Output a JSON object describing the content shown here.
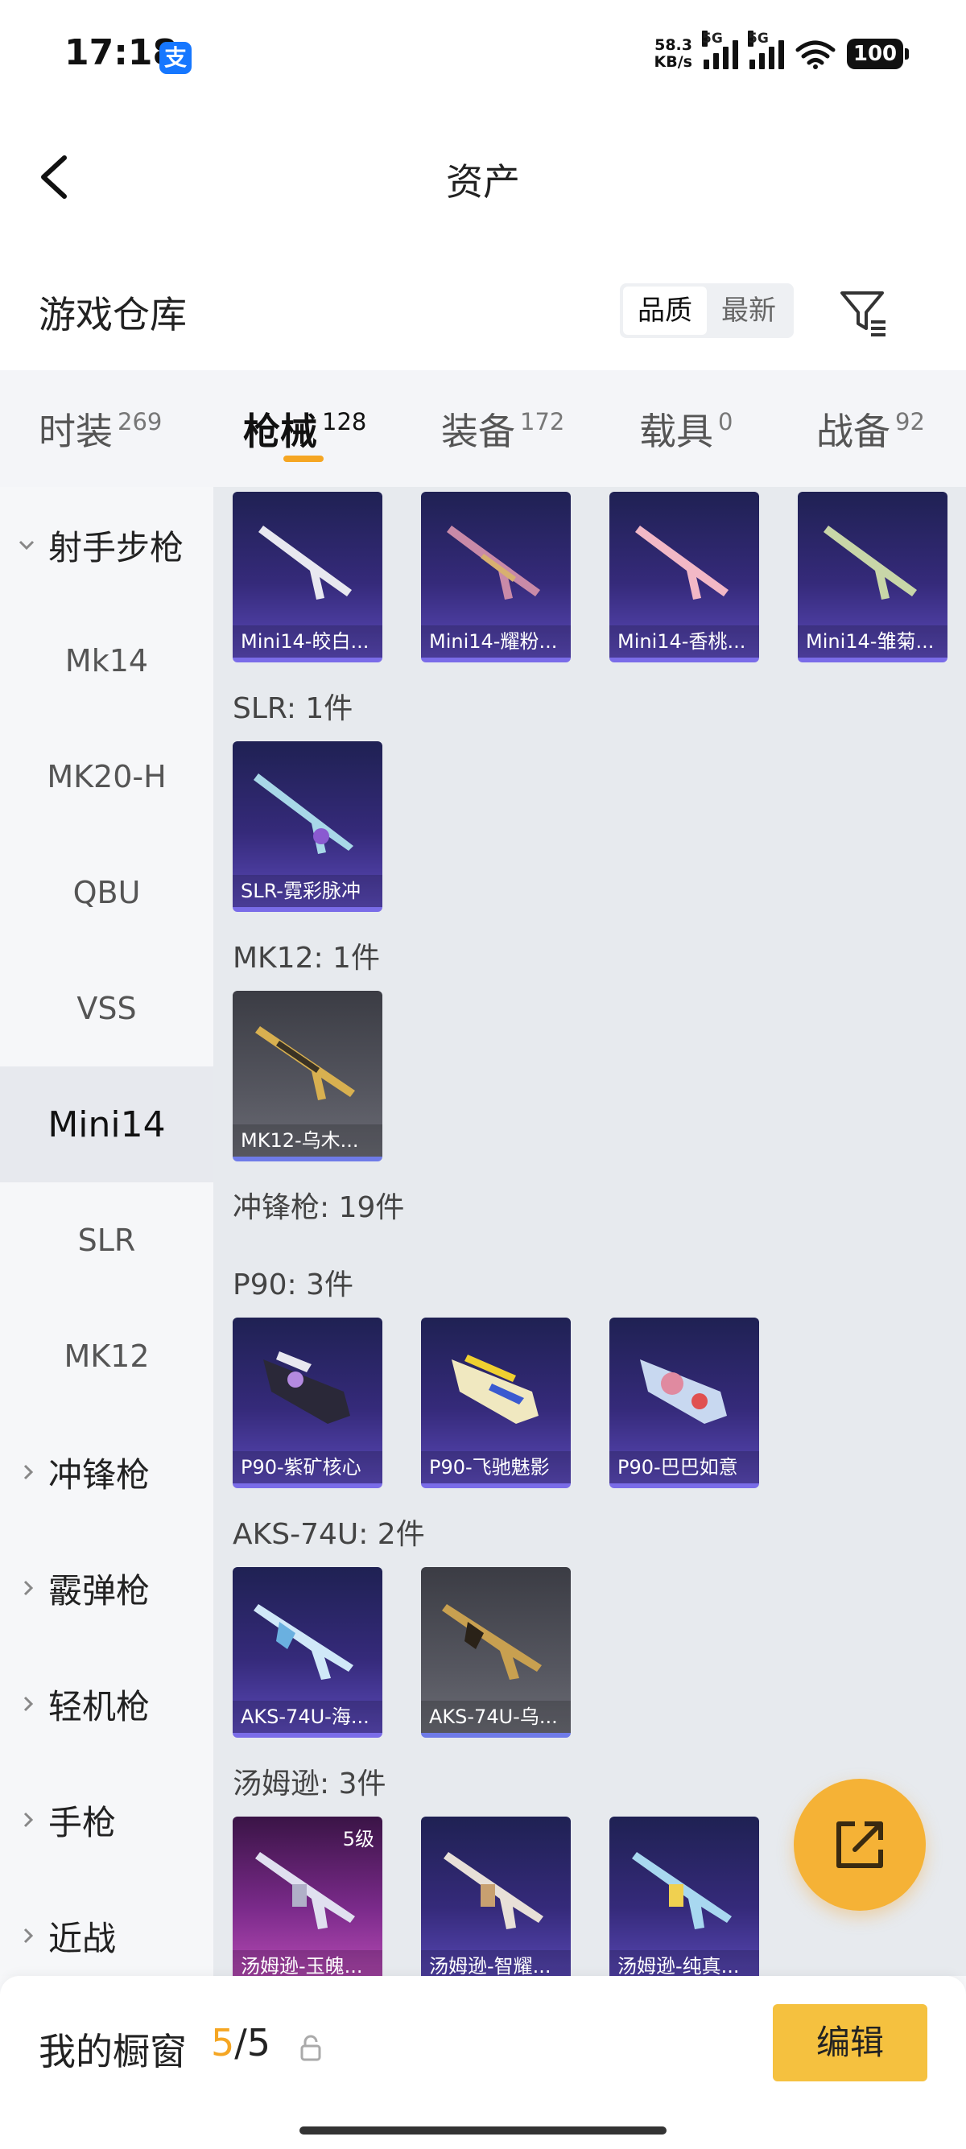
{
  "status": {
    "time": "17:18",
    "app_badge": "支",
    "net_speed_top": "58.3",
    "net_speed_bottom": "KB/s",
    "sig1": "5G",
    "sig2": "5G",
    "battery": "100"
  },
  "header": {
    "title": "资产"
  },
  "warehouse": {
    "title": "游戏仓库",
    "sort_options": [
      "品质",
      "最新"
    ],
    "active_sort": "品质"
  },
  "tabs": [
    {
      "label": "时装",
      "count": "269"
    },
    {
      "label": "枪械",
      "count": "128"
    },
    {
      "label": "装备",
      "count": "172"
    },
    {
      "label": "载具",
      "count": "0"
    },
    {
      "label": "战备",
      "count": "92"
    }
  ],
  "active_tab": "枪械",
  "sidebar": {
    "items": [
      {
        "label": "射手步枪"
      },
      {
        "label": "Mk14"
      },
      {
        "label": "MK20-H"
      },
      {
        "label": "QBU"
      },
      {
        "label": "VSS"
      },
      {
        "label": "Mini14"
      },
      {
        "label": "SLR"
      },
      {
        "label": "MK12"
      },
      {
        "label": "冲锋枪"
      },
      {
        "label": "霰弹枪"
      },
      {
        "label": "轻机枪"
      },
      {
        "label": "手枪"
      },
      {
        "label": "近战"
      }
    ]
  },
  "content": {
    "groups": {
      "slr": "SLR: 1件",
      "mk12": "MK12: 1件",
      "smg": "冲锋枪: 19件",
      "p90": "P90: 3件",
      "aks": "AKS-74U: 2件",
      "thompson": "汤姆逊: 3件"
    },
    "cards": {
      "mini14": [
        "Mini14-皎白...",
        "Mini14-耀粉...",
        "Mini14-香桃...",
        "Mini14-雏菊..."
      ],
      "slr": [
        "SLR-霓彩脉冲"
      ],
      "mk12": [
        "MK12-乌木..."
      ],
      "p90": [
        "P90-紫矿核心",
        "P90-飞驰魅影",
        "P90-巴巴如意"
      ],
      "aks": [
        "AKS-74U-海...",
        "AKS-74U-乌..."
      ],
      "thompson": [
        "汤姆逊-玉魄...",
        "汤姆逊-智耀...",
        "汤姆逊-纯真..."
      ],
      "level_badge": "5级"
    }
  },
  "bottom": {
    "label": "我的橱窗",
    "count_current": "5",
    "count_total": "/5",
    "edit_label": "编辑"
  },
  "colors": {
    "accent": "#f5a623",
    "edit_button": "#f5c13f",
    "fab": "#f5b236",
    "card_purple": "#352a7a"
  }
}
